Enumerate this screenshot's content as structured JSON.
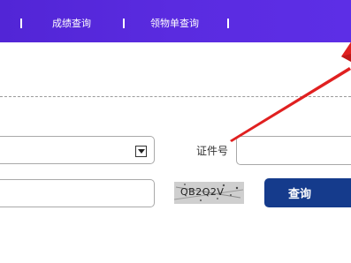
{
  "nav": {
    "items": [
      {
        "label": "成绩查询"
      },
      {
        "label": "领物单查询"
      }
    ],
    "separator": "|"
  },
  "form": {
    "id_label": "证件号",
    "captcha_text": "QB2Q2V",
    "query_button": "查询"
  },
  "colors": {
    "nav_bg": "#5a2be0",
    "button_bg": "#153b8c",
    "annotation_arrow": "#e02020"
  }
}
